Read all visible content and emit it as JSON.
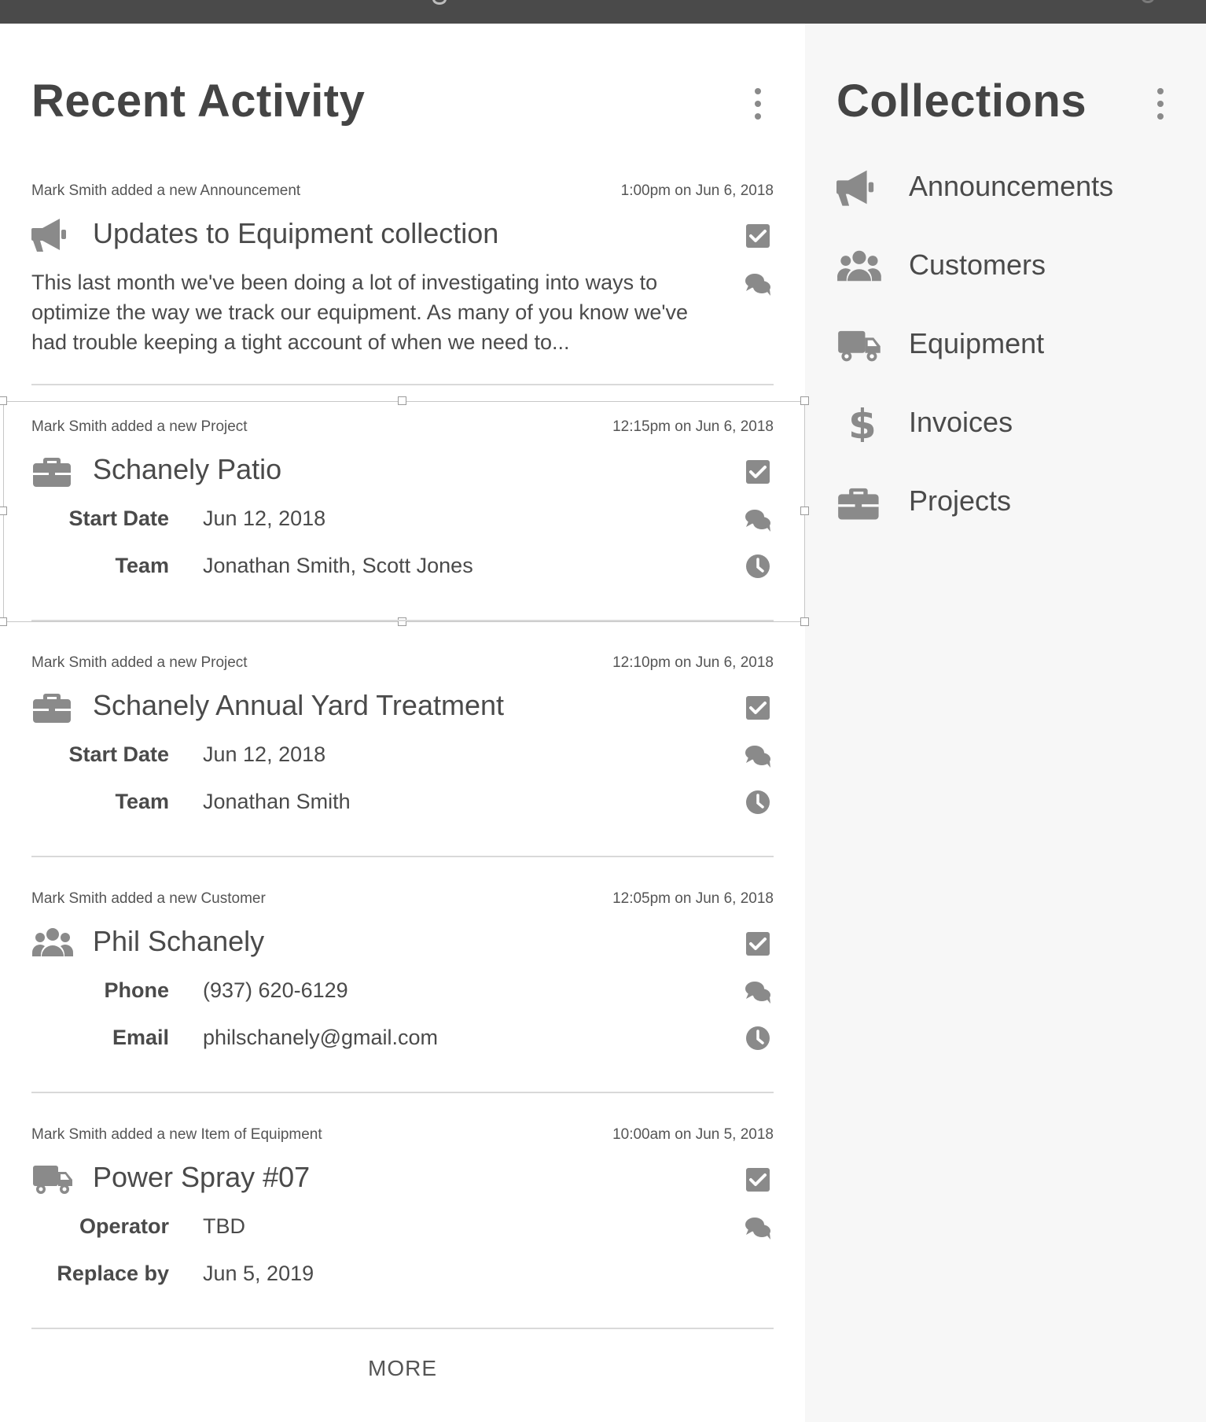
{
  "recent": {
    "title": "Recent Activity",
    "entries": [
      {
        "meta": "Mark Smith added a new Announcement",
        "time": "1:00pm on Jun 6, 2018",
        "icon": "megaphone-icon",
        "title": "Updates to Equipment collection",
        "body": "This last month we've been doing a lot of investigating into ways to optimize the way we track our equipment. As many of you know we've had trouble keeping a tight account of when we need to..."
      },
      {
        "meta": "Mark Smith added a new Project",
        "time": "12:15pm on Jun 6, 2018",
        "icon": "briefcase-icon",
        "title": "Schanely Patio",
        "fields": [
          {
            "label": "Start Date",
            "value": "Jun 12, 2018"
          },
          {
            "label": "Team",
            "value": "Jonathan Smith, Scott Jones"
          }
        ]
      },
      {
        "meta": "Mark Smith added a new Project",
        "time": "12:10pm on Jun 6, 2018",
        "icon": "briefcase-icon",
        "title": "Schanely Annual Yard Treatment",
        "fields": [
          {
            "label": "Start Date",
            "value": "Jun 12, 2018"
          },
          {
            "label": "Team",
            "value": "Jonathan Smith"
          }
        ]
      },
      {
        "meta": "Mark Smith added a new Customer",
        "time": "12:05pm on Jun 6, 2018",
        "icon": "users-icon",
        "title": "Phil Schanely",
        "fields": [
          {
            "label": "Phone",
            "value": "(937) 620-6129"
          },
          {
            "label": "Email",
            "value": "philschanely@gmail.com"
          }
        ]
      },
      {
        "meta": "Mark Smith added a new Item of Equipment",
        "time": "10:00am on Jun 5, 2018",
        "icon": "truck-icon",
        "title": "Power Spray #07",
        "fields": [
          {
            "label": "Operator",
            "value": "TBD"
          },
          {
            "label": "Replace by",
            "value": "Jun 5, 2019"
          }
        ]
      }
    ],
    "more_label": "MORE"
  },
  "collections": {
    "title": "Collections",
    "items": [
      {
        "label": "Announcements",
        "icon": "megaphone-icon"
      },
      {
        "label": "Customers",
        "icon": "users-icon"
      },
      {
        "label": "Equipment",
        "icon": "truck-icon"
      },
      {
        "label": "Invoices",
        "icon": "dollar-icon"
      },
      {
        "label": "Projects",
        "icon": "briefcase-icon"
      }
    ]
  },
  "colors": {
    "topbar": "#4a4a4a",
    "icon_gray": "#8a8a8a",
    "sidebar_bg": "#f7f7f7",
    "text": "#4a4a4a"
  }
}
